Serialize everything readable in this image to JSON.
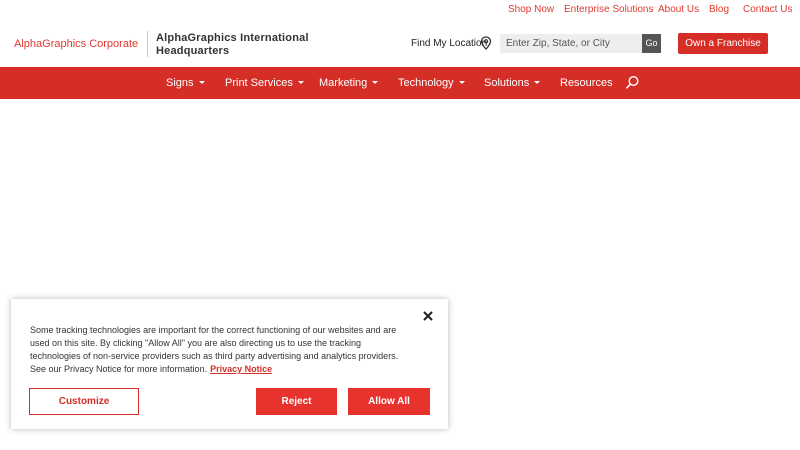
{
  "topbar": {
    "links": [
      "Shop Now",
      "Enterprise Solutions",
      "About Us",
      "Blog",
      "Contact Us"
    ]
  },
  "header": {
    "brand": "AlphaGraphics Corporate",
    "location_name": "AlphaGraphics International Headquarters",
    "find_location_label": "Find My Location",
    "location_icon": "map-pin-icon",
    "search_placeholder": "Enter Zip, State, or City",
    "go_label": "Go",
    "franchise_label": "Own a Franchise"
  },
  "nav": {
    "items": [
      {
        "label": "Signs"
      },
      {
        "label": "Print Services"
      },
      {
        "label": "Marketing"
      },
      {
        "label": "Technology"
      },
      {
        "label": "Solutions"
      },
      {
        "label": "Resources"
      }
    ],
    "search_icon": "search-icon"
  },
  "cookie": {
    "text": "Some tracking technologies are important for the correct functioning of our websites and are used on this site. By clicking \"Allow All\" you are also directing us to use the tracking technologies of non-service providers such as third party advertising and analytics providers. See our Privacy Notice for more information.",
    "privacy_link": "Privacy Notice",
    "customize_label": "Customize",
    "reject_label": "Reject",
    "allow_label": "Allow All",
    "close_icon": "close-icon"
  },
  "colors": {
    "brand_red": "#d42e26",
    "button_red": "#e8322d",
    "link_red": "#e03a2f"
  }
}
